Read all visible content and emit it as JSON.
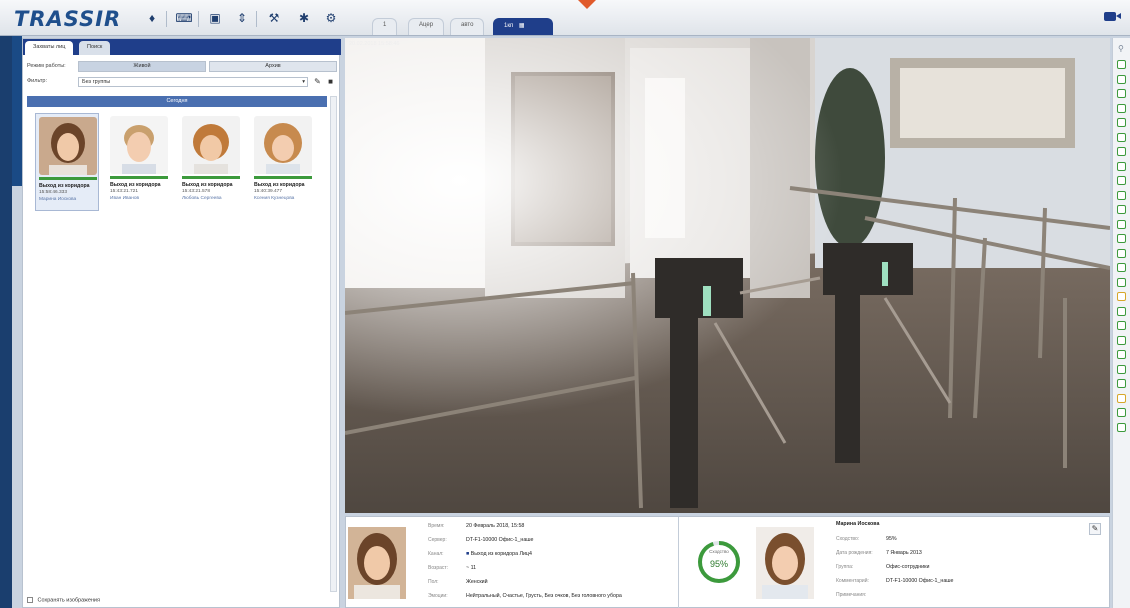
{
  "app": {
    "logo": "TRASSIR",
    "accent": "#1f3e8a"
  },
  "toolbar": {
    "icons": [
      "bell-icon",
      "keyboard-icon",
      "monitor-icon",
      "layout-icon",
      "wrench-icon",
      "puzzle-icon",
      "settings-icon"
    ],
    "tabs": [
      "1",
      "Ацер",
      "авто",
      "1кп"
    ],
    "active_tab_index": 3
  },
  "left_panel": {
    "tabs": [
      "Захваты лиц",
      "Поиск"
    ],
    "mode_label": "Режим работы:",
    "mode_options": [
      "Живой",
      "Архив"
    ],
    "filter_label": "Фильтр:",
    "filter_value": "Без группы",
    "section_title": "Сегодня",
    "faces": [
      {
        "title": "Выход из коридора",
        "time": "15:58:46.333",
        "name": "Марина Иоскова"
      },
      {
        "title": "Выход из коридора",
        "time": "15:43:21.721",
        "name": "Иван Иванов"
      },
      {
        "title": "Выход из коридора",
        "time": "15:43:21.578",
        "name": "Любовь Сергеева"
      },
      {
        "title": "Выход из коридора",
        "time": "15:40:39.477",
        "name": "Ксения Кузнецова"
      }
    ],
    "save_images_label": "Сохранять изображения"
  },
  "video": {
    "timestamp": "20.02.2018 15:58:46"
  },
  "info_left": {
    "labels": [
      "Время:",
      "Сервер:",
      "Канал:",
      "Возраст:",
      "Пол:",
      "Эмоции:"
    ],
    "values": [
      "20 Февраль 2018, 15:58",
      "DT-F1-10000 Офис-1_наше",
      "Выход из коридора Лиц4",
      "~ 11",
      "Женский",
      "Нейтральный, Счастье, Грусть, Без очков, Без головного убора"
    ]
  },
  "info_right": {
    "match_label": "Сходство",
    "match_percent": 95,
    "match_text": "95%",
    "name": "Марина Иоскова",
    "labels": [
      "Сходство:",
      "Дата рождения:",
      "Группа:",
      "Комментарий:",
      "Примечания:"
    ],
    "values": [
      "95%",
      "7 Январь 2013",
      "Офис-сотрудники",
      "DT-F1-10000 Офис-1_наше",
      ""
    ]
  },
  "right_bar": {
    "indicators": [
      "g",
      "g",
      "g",
      "g",
      "g",
      "g",
      "g",
      "g",
      "g",
      "g",
      "g",
      "g",
      "g",
      "g",
      "g",
      "g",
      "y",
      "g",
      "g",
      "g",
      "g",
      "g",
      "g",
      "y",
      "g",
      "g"
    ]
  }
}
